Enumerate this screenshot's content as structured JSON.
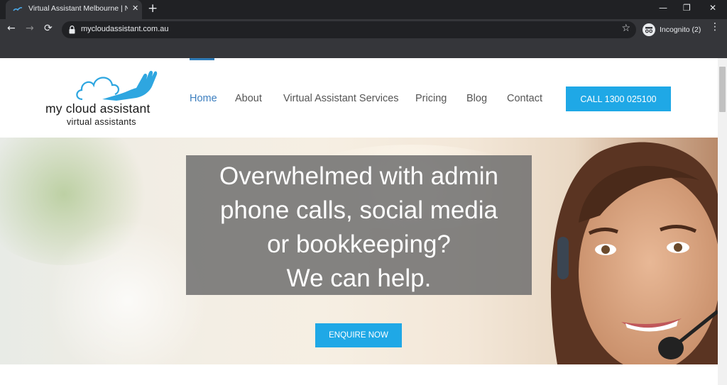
{
  "browser": {
    "tab_title": "Virtual Assistant Melbourne | No",
    "tab_close": "✕",
    "new_tab": "+",
    "window_controls": {
      "minimize": "—",
      "restore": "❐",
      "close": "✕"
    },
    "nav": {
      "back": "←",
      "forward": "→",
      "reload": "⟳"
    },
    "url": "mycloudassistant.com.au",
    "bookmark_star": "☆",
    "incognito_label": "Incognito (2)",
    "menu": "⋮"
  },
  "site": {
    "logo": {
      "name": "my cloud assistant",
      "tagline": "virtual assistants"
    },
    "nav": [
      {
        "label": "Home",
        "active": true
      },
      {
        "label": "About",
        "active": false
      },
      {
        "label": "Virtual Assistant Services",
        "active": false
      },
      {
        "label": "Pricing",
        "active": false
      },
      {
        "label": "Blog",
        "active": false
      },
      {
        "label": "Contact",
        "active": false
      }
    ],
    "call_button": "CALL 1300 025100",
    "hero": {
      "headline_lines": [
        "Overwhelmed with admin",
        "phone calls, social media",
        "or bookkeeping?",
        "We can help."
      ],
      "cta": "ENQUIRE NOW"
    }
  },
  "colors": {
    "accent": "#1fa8e6",
    "nav_active": "#3d7fbf",
    "chrome_dark": "#202124",
    "chrome_toolbar": "#35363a"
  }
}
